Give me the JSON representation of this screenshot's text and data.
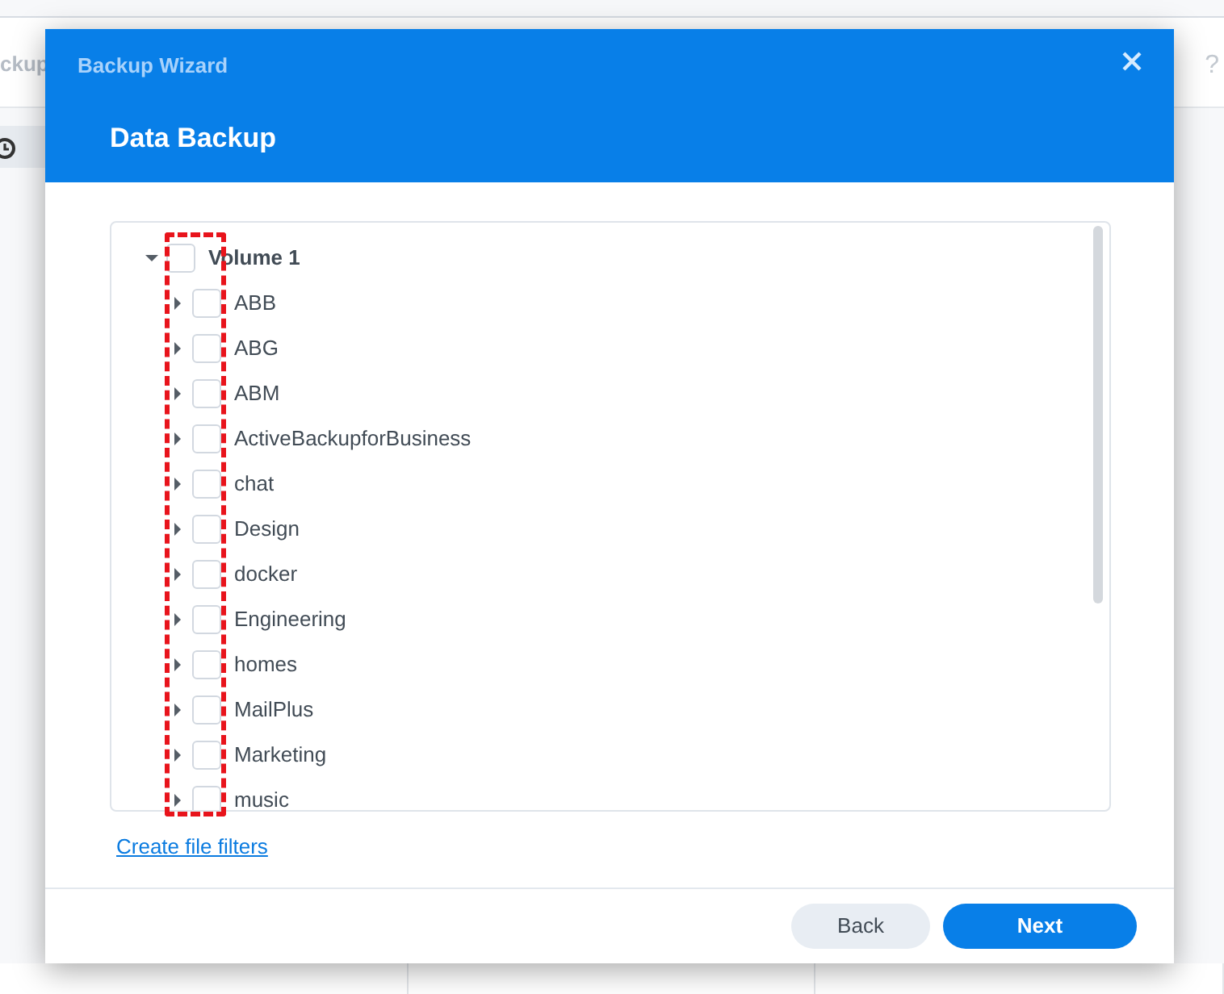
{
  "background_app": {
    "title": "ckup",
    "help": "?"
  },
  "dialog": {
    "title": "Backup Wizard",
    "heading": "Data Backup"
  },
  "tree": {
    "label": "Volume 1",
    "expanded": true,
    "checked": false,
    "children": [
      {
        "label": "ABB",
        "expanded": false,
        "checked": false
      },
      {
        "label": "ABG",
        "expanded": false,
        "checked": false
      },
      {
        "label": "ABM",
        "expanded": false,
        "checked": false
      },
      {
        "label": "ActiveBackupforBusiness",
        "expanded": false,
        "checked": false
      },
      {
        "label": "chat",
        "expanded": false,
        "checked": false
      },
      {
        "label": "Design",
        "expanded": false,
        "checked": false
      },
      {
        "label": "docker",
        "expanded": false,
        "checked": false
      },
      {
        "label": "Engineering",
        "expanded": false,
        "checked": false
      },
      {
        "label": "homes",
        "expanded": false,
        "checked": false
      },
      {
        "label": "MailPlus",
        "expanded": false,
        "checked": false
      },
      {
        "label": "Marketing",
        "expanded": false,
        "checked": false
      },
      {
        "label": "music",
        "expanded": false,
        "checked": false
      }
    ]
  },
  "link": "Create file filters",
  "buttons": [
    {
      "label": "Back",
      "kind": "secondary"
    },
    {
      "label": "Next",
      "kind": "primary"
    }
  ]
}
